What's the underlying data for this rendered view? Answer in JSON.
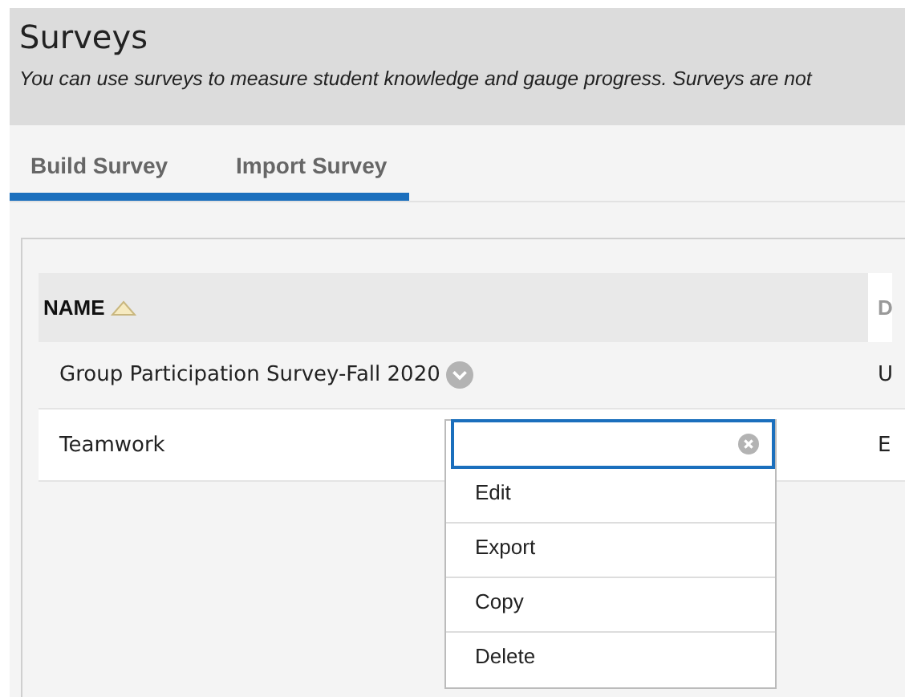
{
  "header": {
    "title": "Surveys",
    "description": "You can use surveys to measure student knowledge and gauge progress. Surveys are not"
  },
  "tabs": [
    {
      "label": "Build Survey",
      "selected": true
    },
    {
      "label": "Import Survey",
      "selected": true
    }
  ],
  "table": {
    "columns": [
      {
        "label": "NAME",
        "sorted_ascending": true
      },
      {
        "label": "D"
      }
    ],
    "rows": [
      {
        "cells": [
          "Group Participation Survey-Fall 2020",
          "U"
        ],
        "has_menu_button": true,
        "highlighted": false
      },
      {
        "cells": [
          "Teamwork",
          "E"
        ],
        "has_menu_button": false,
        "highlighted": true
      }
    ]
  },
  "context_menu": {
    "items": [
      "Edit",
      "Export",
      "Copy",
      "Delete"
    ]
  }
}
